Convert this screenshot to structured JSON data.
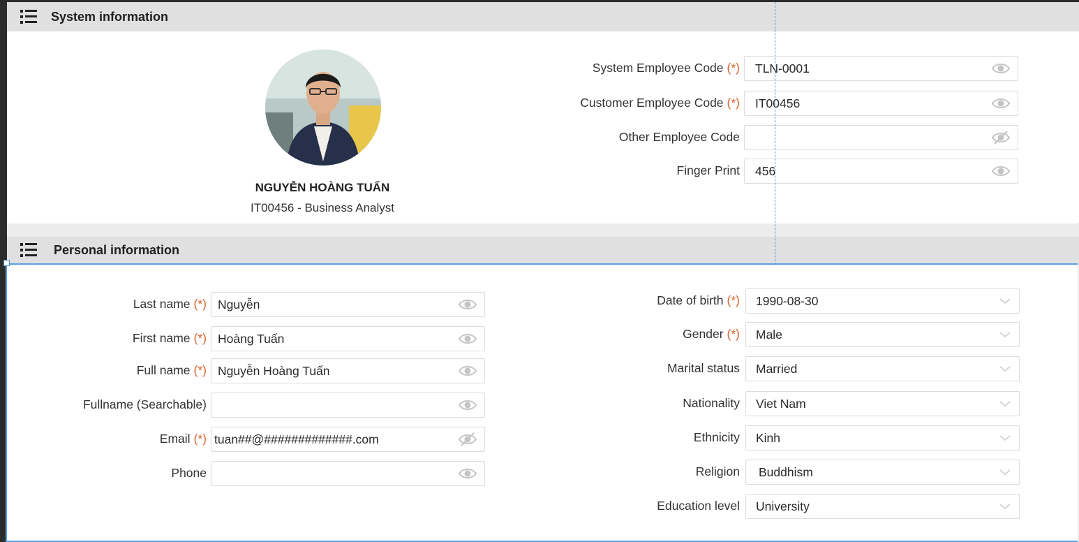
{
  "system_section": {
    "title": "System information",
    "employee_name": "NGUYỄN HOÀNG TUẤN",
    "employee_subtitle": "IT00456 - Business Analyst",
    "fields": [
      {
        "label": "System Employee Code",
        "required": "(*)",
        "value": "TLN-0001",
        "visibility": "eye-icon"
      },
      {
        "label": "Customer Employee Code",
        "required": "(*)",
        "value": "IT00456",
        "visibility": "eye-icon"
      },
      {
        "label": "Other Employee Code",
        "required": "",
        "value": "",
        "visibility": "eye-off-icon"
      },
      {
        "label": "Finger Print",
        "required": "",
        "value": "456",
        "visibility": "eye-icon"
      }
    ]
  },
  "personal_section": {
    "title": "Personal information",
    "left_fields": [
      {
        "label": "Last name",
        "required": "(*)",
        "value": "Nguyễn",
        "visibility": "eye-icon"
      },
      {
        "label": "First name",
        "required": "(*)",
        "value": "Hoàng Tuấn",
        "visibility": "eye-icon"
      },
      {
        "label": "Full name",
        "required": "(*)",
        "value": "Nguyễn Hoàng Tuấn",
        "visibility": "eye-icon"
      },
      {
        "label": "Fullname (Searchable)",
        "required": "",
        "value": "",
        "visibility": "eye-icon"
      },
      {
        "label": "Email",
        "required": "(*)",
        "value": "tuan##@#############.com",
        "visibility": "eye-off-icon"
      },
      {
        "label": "Phone",
        "required": "",
        "value": "",
        "visibility": "eye-icon"
      }
    ],
    "right_fields": [
      {
        "label": "Date of birth",
        "required": "(*)",
        "value": "1990-08-30"
      },
      {
        "label": "Gender",
        "required": "(*)",
        "value": "Male"
      },
      {
        "label": "Marital status",
        "required": "",
        "value": "Married"
      },
      {
        "label": "Nationality",
        "required": "",
        "value": "Viet Nam"
      },
      {
        "label": "Ethnicity",
        "required": "",
        "value": "Kinh"
      },
      {
        "label": "Religion",
        "required": "",
        "value": "Buddhism"
      },
      {
        "label": "Education level",
        "required": "",
        "value": "University"
      }
    ]
  },
  "colors": {
    "required_marker": "#d9622b",
    "selection_border": "#5a9ee0",
    "header_bg": "#e0e0e0"
  }
}
